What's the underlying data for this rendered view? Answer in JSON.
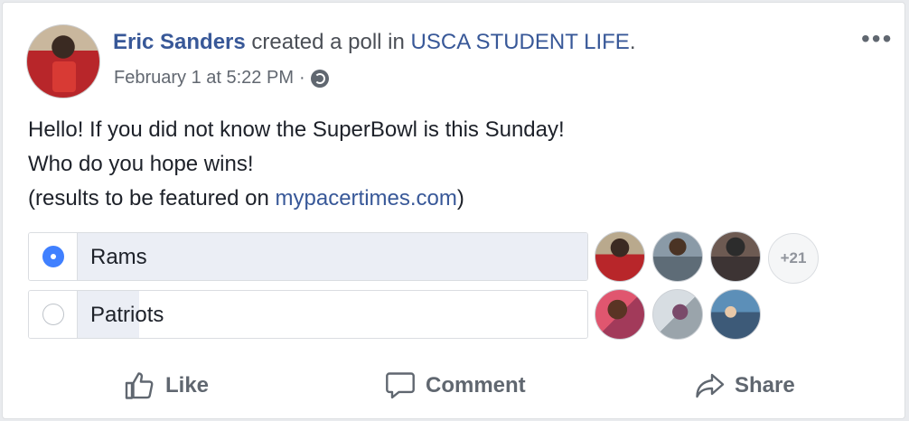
{
  "post": {
    "author": "Eric Sanders",
    "action_text": " created a poll in ",
    "group": "USCA STUDENT LIFE",
    "period": ".",
    "timestamp": "February 1 at 5:22 PM",
    "separator": " · ",
    "privacy_icon": "globe-icon",
    "more_icon": "more-options-icon",
    "more_glyph": "•••",
    "body": {
      "line1": "Hello! If you did not know the SuperBowl is this Sunday!",
      "line2": "Who do you hope wins!",
      "line3_prefix": "(results to be featured on ",
      "link": "mypacertimes.com",
      "line3_suffix": ")"
    }
  },
  "poll": {
    "options": [
      {
        "label": "Rams",
        "selected": true,
        "fill_fraction": 1.0,
        "more_voters": "+21"
      },
      {
        "label": "Patriots",
        "selected": false,
        "fill_fraction": 0.12
      }
    ]
  },
  "actions": {
    "like": "Like",
    "comment": "Comment",
    "share": "Share"
  }
}
